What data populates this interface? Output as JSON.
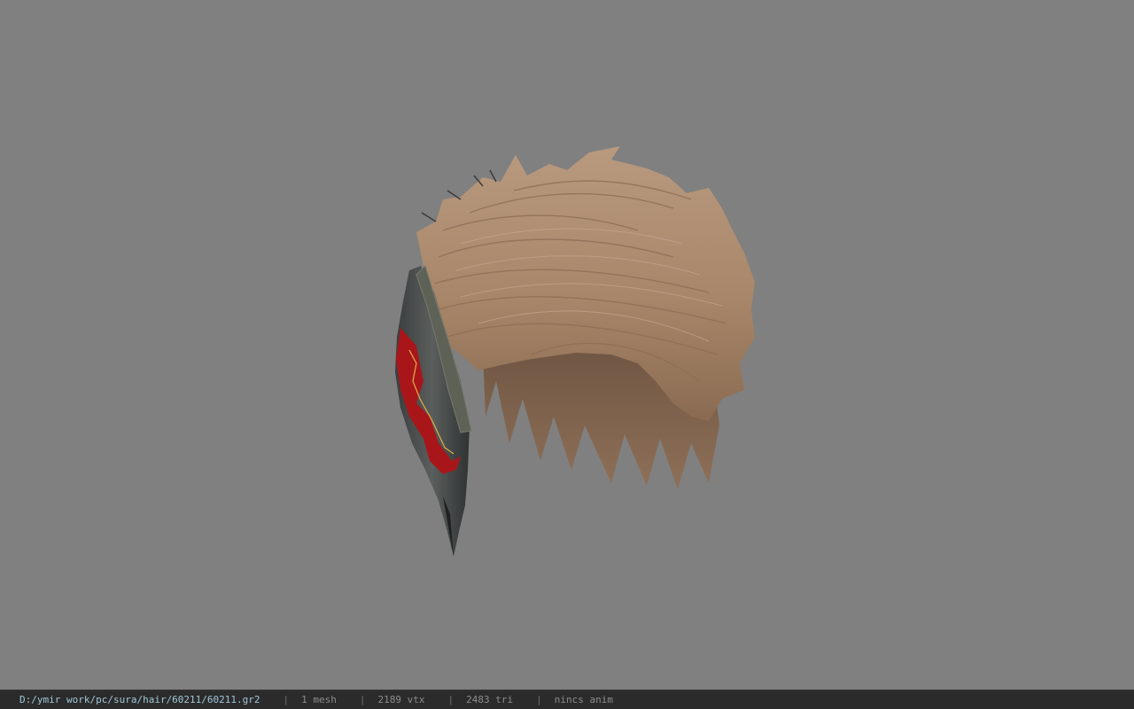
{
  "viewport": {
    "background_color": "#808080",
    "model": {
      "icon": "hair-mesh-model",
      "hair_color": "#b08d70",
      "accessory_accent_color": "#b01a1a"
    }
  },
  "statusbar": {
    "file_path": "D:/ymir work/pc/sura/hair/60211/60211.gr2",
    "separator": "|",
    "mesh_count": "1 mesh",
    "vertex_count": "2189 vtx",
    "triangle_count": "2483 tri",
    "anim_status": "nincs anim"
  }
}
